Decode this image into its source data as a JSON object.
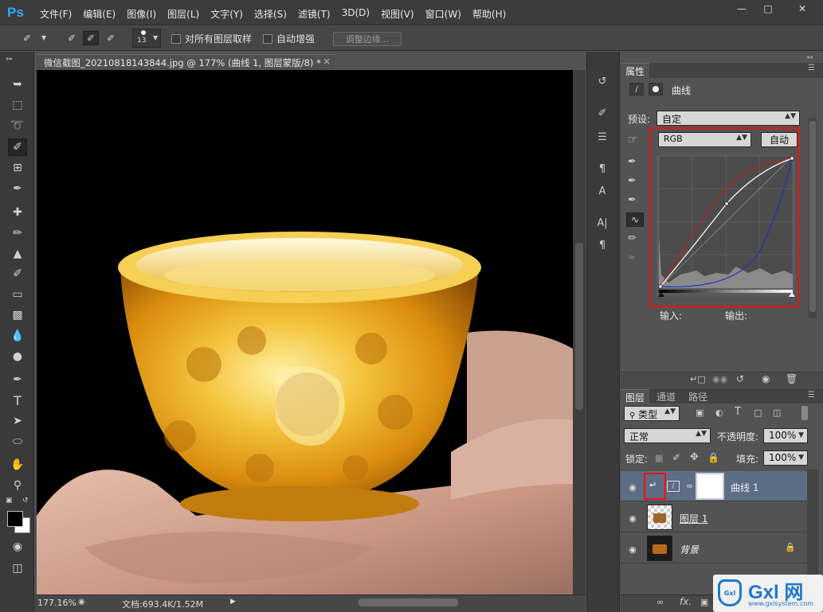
{
  "app": {
    "logo": "Ps",
    "menu": [
      "文件(F)",
      "编辑(E)",
      "图像(I)",
      "图层(L)",
      "文字(Y)",
      "选择(S)",
      "滤镜(T)",
      "3D(D)",
      "视图(V)",
      "窗口(W)",
      "帮助(H)"
    ]
  },
  "options_bar": {
    "brush_size": "13",
    "sample_all_layers": "对所有图层取样",
    "auto_enhance": "自动增强",
    "refine_edge": "调整边缘..."
  },
  "document": {
    "tab_title": "微信截图_20210818143844.jpg @ 177% (曲线 1, 图层蒙版/8) *",
    "zoom": "177.16%",
    "doc_size": "文档:693.4K/1.52M"
  },
  "properties": {
    "tab": "属性",
    "adjustment_name": "曲线",
    "preset_label": "预设:",
    "preset_value": "自定",
    "channel": "RGB",
    "auto_button": "自动",
    "input_label": "输入:",
    "output_label": "输出:"
  },
  "layers_panel": {
    "tabs": [
      "图层",
      "通道",
      "路径"
    ],
    "filter_kind": "类型",
    "blend_mode": "正常",
    "opacity_label": "不透明度:",
    "opacity_value": "100%",
    "lock_label": "锁定:",
    "fill_label": "填充:",
    "fill_value": "100%",
    "layers": [
      {
        "name": "曲线 1",
        "selected": true
      },
      {
        "name": "图层 1",
        "selected": false
      },
      {
        "name": "背景",
        "selected": false
      }
    ]
  },
  "watermark": {
    "brand": "Gxl 网",
    "url": "www.gxlsystem.com"
  }
}
